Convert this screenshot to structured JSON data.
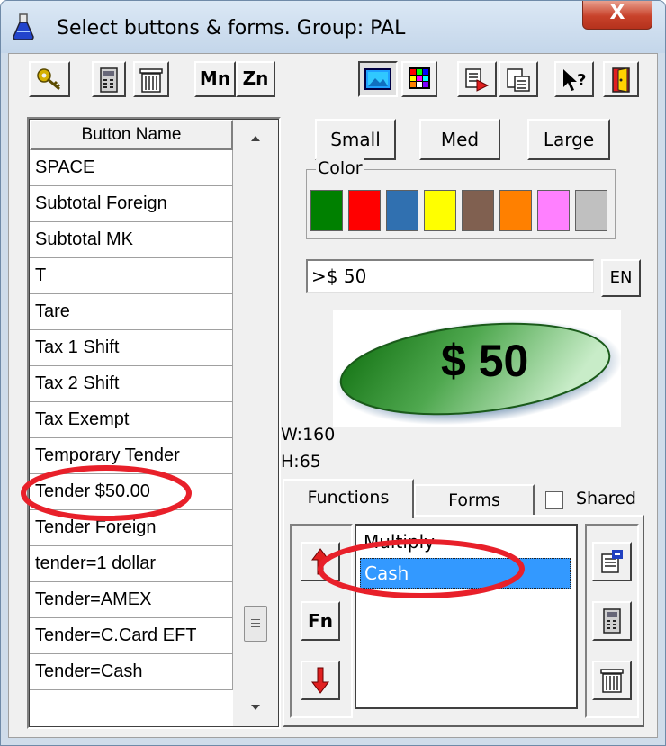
{
  "window": {
    "title": "Select buttons & forms.  Group: PAL",
    "close_glyph": "X"
  },
  "toolbar": {
    "buttons": [
      {
        "name": "key-icon"
      },
      {
        "name": "calculator-icon"
      },
      {
        "name": "trash-icon"
      },
      {
        "label": "Mn"
      },
      {
        "label": "Zn"
      },
      {
        "name": "screen-icon"
      },
      {
        "name": "color-grid-icon"
      },
      {
        "name": "copy-doc-icon"
      },
      {
        "name": "paste-doc-icon"
      },
      {
        "name": "help-pointer-icon"
      },
      {
        "name": "exit-door-icon"
      }
    ]
  },
  "grid": {
    "header": "Button Name",
    "rows": [
      "SPACE",
      "Subtotal Foreign",
      "Subtotal MK",
      "T",
      "Tare",
      "Tax 1 Shift",
      "Tax 2 Shift",
      "Tax Exempt",
      "Temporary Tender",
      "Tender $50.00",
      "Tender Foreign",
      "tender=1 dollar",
      "Tender=AMEX",
      "Tender=C.Card EFT",
      "Tender=Cash"
    ],
    "highlighted_row": "Tender $50.00"
  },
  "size_buttons": {
    "small": "Small",
    "med": "Med",
    "large": "Large"
  },
  "color_group": {
    "label": "Color",
    "swatches": [
      "#008000",
      "#ff0000",
      "#3070b0",
      "#ffff00",
      "#806050",
      "#ff8000",
      "#ff80ff",
      "#c0c0c0"
    ]
  },
  "button_text": {
    "value": ">$ 50",
    "lang_button": "EN"
  },
  "preview": {
    "label": "$ 50",
    "width": "W:160",
    "height": "H:65"
  },
  "tabs": {
    "functions": "Functions",
    "forms": "Forms",
    "shared": "Shared"
  },
  "functions": {
    "items": [
      "Multiply",
      "Cash"
    ],
    "selected": "Cash",
    "fn_button": "Fn"
  },
  "accent": {
    "annotation_red": "#e8202a",
    "selection_blue": "#3399ff"
  }
}
